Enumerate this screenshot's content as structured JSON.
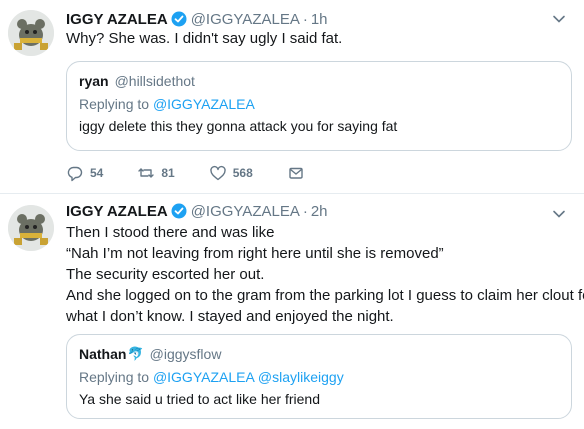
{
  "tweets": [
    {
      "author_name": "IGGY AZALEA",
      "author_handle": "@IGGYAZALEA",
      "time": "1h",
      "text_lines": [
        "Why? She was. I didn't say ugly I said fat."
      ],
      "quote": {
        "name": "ryan",
        "handle": "@hillsidethot",
        "replying_prefix": "Replying to ",
        "replying_to": "@IGGYAZALEA",
        "text": "iggy delete this they gonna attack you for saying fat"
      },
      "actions": {
        "replies": "54",
        "retweets": "81",
        "likes": "568"
      }
    },
    {
      "author_name": "IGGY AZALEA",
      "author_handle": "@IGGYAZALEA",
      "time": "2h",
      "text_lines": [
        "Then I stood there and was like",
        "“Nah I’m not leaving from right here until she is removed”",
        "The security escorted her out.",
        "And she logged on to the gram from the parking lot I guess to claim her clout for",
        "what I don’t know. I stayed and enjoyed the night."
      ],
      "quote": {
        "name": "Nathan",
        "emoji": "🐬",
        "handle": "@iggysflow",
        "replying_prefix": "Replying to ",
        "replying_to": "@IGGYAZALEA @slaylikeiggy",
        "text": "Ya she said u tried to act like her friend"
      }
    }
  ],
  "colors": {
    "text": "#14171a",
    "muted": "#657786",
    "link": "#1da1f2",
    "verified": "#1da1f2",
    "border": "#ccd6dd"
  },
  "icons": {
    "verified": "verified-badge-icon",
    "caret": "chevron-down-icon",
    "reply": "reply-icon",
    "retweet": "retweet-icon",
    "like": "heart-icon",
    "message": "envelope-icon"
  }
}
